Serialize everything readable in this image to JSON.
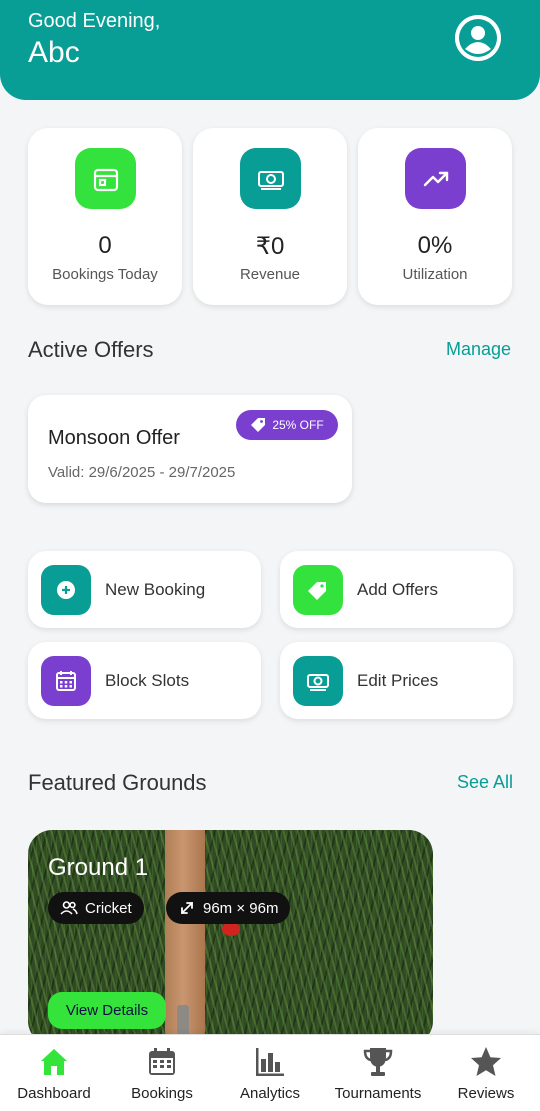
{
  "header": {
    "greeting": "Good Evening,",
    "username": "Abc"
  },
  "stats": [
    {
      "value": "0",
      "label": "Bookings Today",
      "icon": "calendar-icon",
      "color": "#33e23c"
    },
    {
      "value": "₹0",
      "label": "Revenue",
      "icon": "cash-icon",
      "color": "#089d95"
    },
    {
      "value": "0%",
      "label": "Utilization",
      "icon": "trending-up-icon",
      "color": "#7a3fcf"
    }
  ],
  "offers": {
    "title": "Active Offers",
    "manage_label": "Manage",
    "items": [
      {
        "title": "Monsoon Offer",
        "badge": "25% OFF",
        "valid": "Valid: 29/6/2025 - 29/7/2025"
      }
    ]
  },
  "actions": [
    {
      "label": "New Booking",
      "icon": "plus-circle-icon",
      "color": "#089d95"
    },
    {
      "label": "Add Offers",
      "icon": "tag-icon",
      "color": "#33e23c"
    },
    {
      "label": "Block Slots",
      "icon": "calendar-grid-icon",
      "color": "#7a3fcf"
    },
    {
      "label": "Edit Prices",
      "icon": "cash-icon",
      "color": "#089d95"
    }
  ],
  "featured": {
    "title": "Featured Grounds",
    "see_all_label": "See All",
    "grounds": [
      {
        "name": "Ground 1",
        "sport": "Cricket",
        "size": "96m × 96m",
        "button": "View Details"
      }
    ]
  },
  "nav": [
    {
      "label": "Dashboard",
      "icon": "home-icon",
      "active": true
    },
    {
      "label": "Bookings",
      "icon": "calendar-icon"
    },
    {
      "label": "Analytics",
      "icon": "bar-chart-icon"
    },
    {
      "label": "Tournaments",
      "icon": "trophy-icon"
    },
    {
      "label": "Reviews",
      "icon": "star-icon"
    }
  ],
  "colors": {
    "primary": "#089d95",
    "accent_green": "#33e23c",
    "accent_purple": "#7a3fcf",
    "nav_active": "#35e43a",
    "nav_inactive": "#555555"
  }
}
